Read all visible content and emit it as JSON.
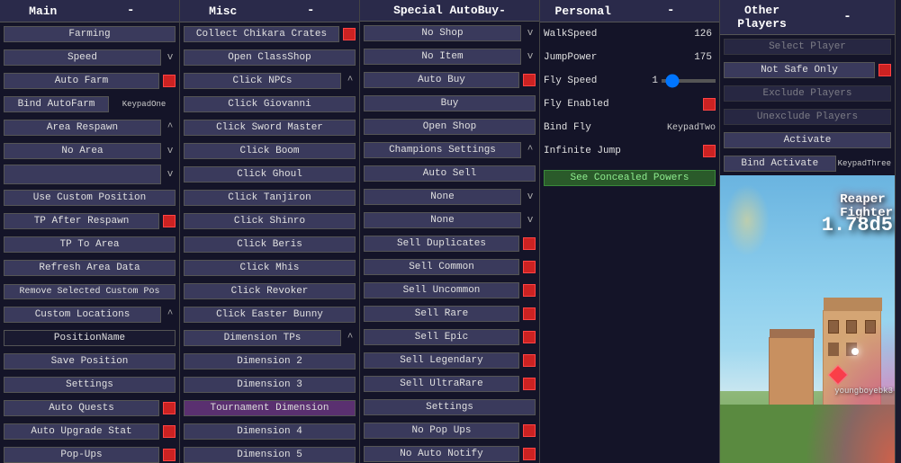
{
  "panels": {
    "main": {
      "header": "Main",
      "minus": "-",
      "items": [
        {
          "label": "Farming",
          "type": "btn"
        },
        {
          "label": "Speed",
          "type": "btn-v"
        },
        {
          "label": "Auto Farm",
          "type": "btn-red"
        },
        {
          "label": "Bind AutoFarm",
          "type": "btn-key",
          "key": "KeypadOne"
        },
        {
          "label": "Area Respawn",
          "type": "btn-arrow"
        },
        {
          "label": "No Area",
          "type": "btn-v"
        },
        {
          "label": "",
          "type": "btn-v"
        },
        {
          "label": "Use Custom Position",
          "type": "btn"
        },
        {
          "label": "TP After Respawn",
          "type": "btn-red"
        },
        {
          "label": "TP To Area",
          "type": "btn"
        },
        {
          "label": "Refresh Area Data",
          "type": "btn"
        },
        {
          "label": "Remove Selected Custom Pos",
          "type": "btn"
        },
        {
          "label": "Custom Locations",
          "type": "btn-arrow"
        },
        {
          "label": "PositionName",
          "type": "input"
        },
        {
          "label": "Save Position",
          "type": "btn"
        },
        {
          "label": "Settings",
          "type": "btn"
        },
        {
          "label": "Auto Quests",
          "type": "btn-red"
        },
        {
          "label": "Auto Upgrade Stat",
          "type": "btn-red"
        },
        {
          "label": "Pop-Ups",
          "type": "btn-red"
        }
      ]
    },
    "misc": {
      "header": "Misc",
      "minus": "-",
      "items": [
        {
          "label": "Collect Chikara Crates",
          "type": "btn-red"
        },
        {
          "label": "Open ClassShop",
          "type": "btn"
        },
        {
          "label": "Click NPCs",
          "type": "btn-arrow"
        },
        {
          "label": "Click Giovanni",
          "type": "btn"
        },
        {
          "label": "Click Sword Master",
          "type": "btn"
        },
        {
          "label": "Click Boom",
          "type": "btn"
        },
        {
          "label": "Click Ghoul",
          "type": "btn"
        },
        {
          "label": "Click Tanjiron",
          "type": "btn"
        },
        {
          "label": "Click Shinro",
          "type": "btn"
        },
        {
          "label": "Click Beris",
          "type": "btn"
        },
        {
          "label": "Click Mhis",
          "type": "btn"
        },
        {
          "label": "Click Revoker",
          "type": "btn"
        },
        {
          "label": "Click Easter Bunny",
          "type": "btn"
        },
        {
          "label": "Dimension TPs",
          "type": "btn-arrow"
        },
        {
          "label": "Dimension 2",
          "type": "btn"
        },
        {
          "label": "Dimension 3",
          "type": "btn"
        },
        {
          "label": "Tournament Dimension",
          "type": "btn-highlight"
        },
        {
          "label": "Dimension 4",
          "type": "btn"
        },
        {
          "label": "Dimension 5",
          "type": "btn"
        }
      ]
    },
    "special": {
      "header": "Special AutoBuy-",
      "minus": "",
      "items": [
        {
          "label": "No Shop",
          "type": "btn-v"
        },
        {
          "label": "No Item",
          "type": "btn-v"
        },
        {
          "label": "Auto Buy",
          "type": "btn-red"
        },
        {
          "label": "Buy",
          "type": "btn"
        },
        {
          "label": "Open Shop",
          "type": "btn"
        },
        {
          "label": "Champions Settings",
          "type": "btn-arrow"
        },
        {
          "label": "Auto Sell",
          "type": "btn"
        },
        {
          "label": "None",
          "type": "btn-v"
        },
        {
          "label": "None",
          "type": "btn-v"
        },
        {
          "label": "Sell Duplicates",
          "type": "btn-red"
        },
        {
          "label": "Sell Common",
          "type": "btn-red"
        },
        {
          "label": "Sell Uncommon",
          "type": "btn-red"
        },
        {
          "label": "Sell Rare",
          "type": "btn-red"
        },
        {
          "label": "Sell Epic",
          "type": "btn-red"
        },
        {
          "label": "Sell Legendary",
          "type": "btn-red"
        },
        {
          "label": "Sell UltraRare",
          "type": "btn-red"
        },
        {
          "label": "Settings",
          "type": "btn"
        },
        {
          "label": "No Pop Ups",
          "type": "btn-red"
        },
        {
          "label": "No Auto Notify",
          "type": "btn-red"
        }
      ]
    },
    "personal": {
      "header": "Personal",
      "minus": "-",
      "walkspeed_label": "WalkSpeed",
      "walkspeed_value": "126",
      "jumppower_label": "JumpPower",
      "jumppower_value": "175",
      "flyspeed_label": "Fly Speed",
      "flyspeed_value": "1",
      "flyenabled_label": "Fly Enabled",
      "bindflykey_label": "Bind Fly",
      "bindflykey_value": "KeypadTwo",
      "infinitejump_label": "Infinite Jump",
      "concealed_label": "See Concealed Powers",
      "items": []
    },
    "other": {
      "header": "Other Players",
      "minus": "-",
      "items": [
        {
          "label": "Select Player",
          "type": "btn-dimmed"
        },
        {
          "label": "Not Safe Only",
          "type": "btn-red"
        },
        {
          "label": "Exclude Players",
          "type": "btn-dimmed"
        },
        {
          "label": "Unexclude Players",
          "type": "btn-dimmed"
        },
        {
          "label": "Activate",
          "type": "btn"
        },
        {
          "label": "Bind Activate",
          "type": "btn-key",
          "key": "KeypadThree"
        }
      ]
    }
  },
  "game": {
    "fighter_text": "Reaper",
    "fighter_sub": "Fighter",
    "level": "1.7",
    "level2": "8d5",
    "username": "youngboyebk3"
  }
}
